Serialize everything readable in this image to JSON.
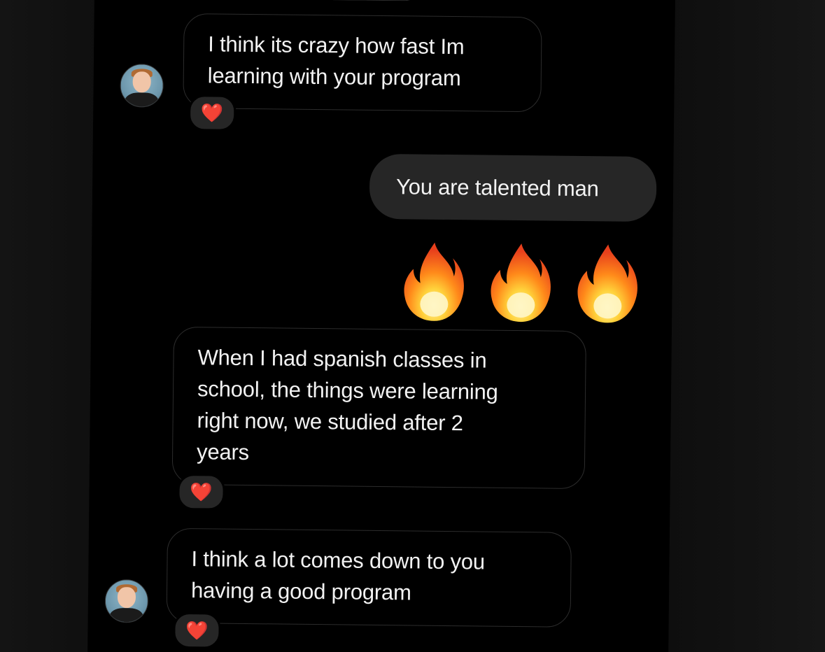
{
  "conversation": {
    "messages": [
      {
        "direction": "incoming",
        "text_lines": [
          "I think its crazy how fast Im",
          "learning with your program"
        ],
        "reaction": "❤️",
        "has_avatar": true
      },
      {
        "direction": "outgoing",
        "text_lines": [
          "You are talented man"
        ]
      },
      {
        "direction": "outgoing",
        "emoji": "🔥🔥🔥"
      },
      {
        "direction": "incoming",
        "text_lines": [
          "When I had spanish classes in",
          "school, the things were learning",
          "right now, we studied after 2",
          "years"
        ],
        "reaction": "❤️",
        "has_avatar": false
      },
      {
        "direction": "incoming",
        "text_lines": [
          "I think a lot comes down to you",
          "having a good program"
        ],
        "reaction": "❤️",
        "has_avatar": true
      }
    ]
  },
  "colors": {
    "background": "#000000",
    "outgoing_bubble": "#262626",
    "incoming_border": "#2c2c2c",
    "text": "#f2f2f2",
    "heart": "#ff2b3a"
  },
  "icons": {
    "avatar": "user-avatar-photo",
    "reaction": "red-heart-icon",
    "fire": "fire-emoji"
  }
}
